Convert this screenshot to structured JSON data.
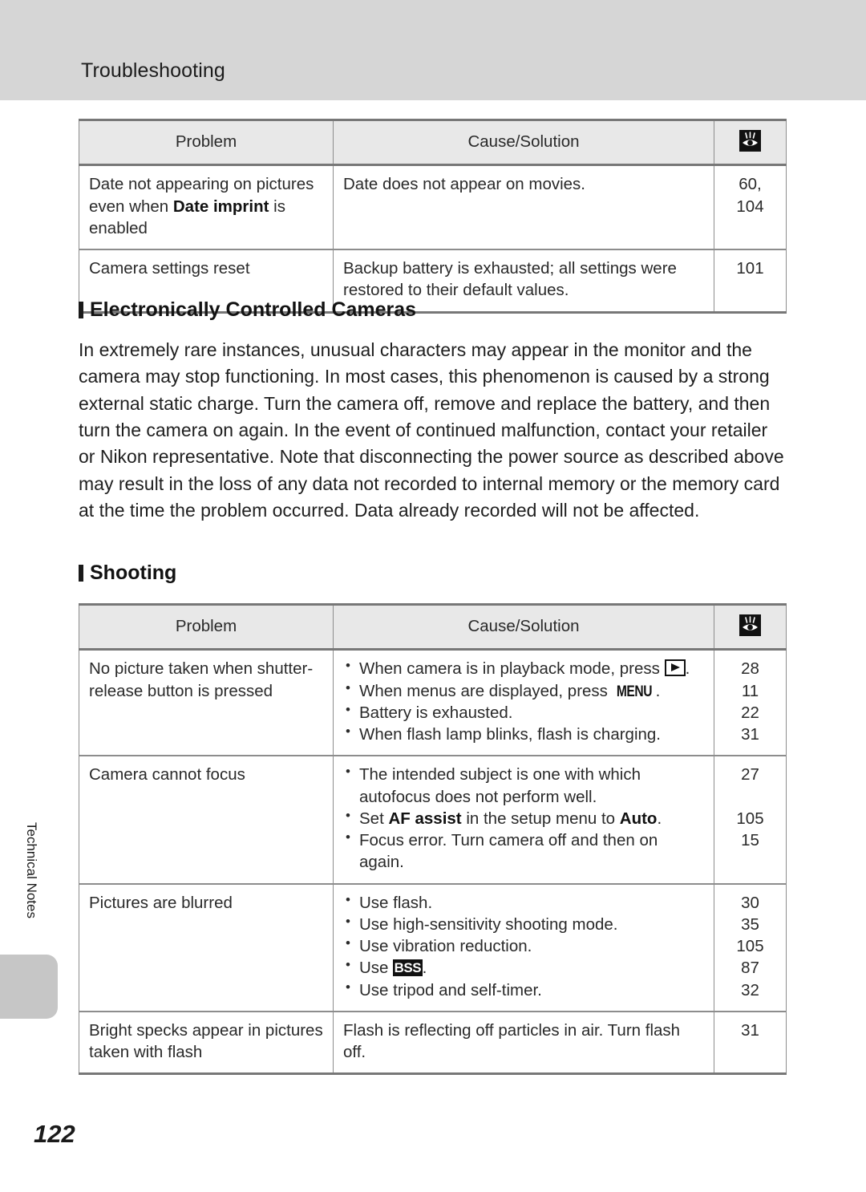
{
  "header": {
    "title": "Troubleshooting"
  },
  "side_tab": {
    "label": "Technical Notes"
  },
  "footer": {
    "page_number": "122"
  },
  "table_columns": {
    "problem": "Problem",
    "cause_solution": "Cause/Solution",
    "reference_icon": "reference-page-icon"
  },
  "table_one": {
    "rows": [
      {
        "problem_pre": "Date not appearing on pictures even when ",
        "problem_bold": "Date imprint",
        "problem_post": " is enabled",
        "cause": "Date does not appear on movies.",
        "refs": [
          "60, 104"
        ]
      },
      {
        "problem_pre": "Camera settings reset",
        "problem_bold": "",
        "problem_post": "",
        "cause": "Backup battery is exhausted; all settings were restored to their default values.",
        "refs": [
          "101"
        ]
      }
    ]
  },
  "section_electronic": {
    "heading": "Electronically Controlled Cameras",
    "paragraph": "In extremely rare instances, unusual characters may appear in the monitor and the camera may stop functioning. In most cases, this phenomenon is caused by a strong external static charge. Turn the camera off, remove and replace the battery, and then turn the camera on again. In the event of continued malfunction, contact your retailer or Nikon representative. Note that disconnecting the power source as described above may result in the loss of any data not recorded to internal memory or the memory card at the time the problem occurred. Data already recorded will not be affected."
  },
  "section_shooting": {
    "heading": "Shooting"
  },
  "table_two": {
    "rows": [
      {
        "problem": "No picture taken when shutter-release button is pressed",
        "bullets": [
          {
            "pre": "When camera is in playback mode, press ",
            "glyph": "playback-icon",
            "post": "."
          },
          {
            "pre": "When menus are displayed, press ",
            "glyph": "menu-icon",
            "post": "."
          },
          {
            "pre": "Battery is exhausted.",
            "glyph": "",
            "post": ""
          },
          {
            "pre": "When flash lamp blinks, flash is charging.",
            "glyph": "",
            "post": ""
          }
        ],
        "refs": [
          "28",
          "11",
          "22",
          "31"
        ]
      },
      {
        "problem": "Camera cannot focus",
        "bullets": [
          {
            "pre": "The intended subject is one with which autofocus does not perform well.",
            "glyph": "",
            "post": ""
          },
          {
            "pre": "Set ",
            "bold1": "AF assist",
            "mid": " in the setup menu to ",
            "bold2": "Auto",
            "post": "."
          },
          {
            "pre": "Focus error. Turn camera off and then on again.",
            "glyph": "",
            "post": ""
          }
        ],
        "refs": [
          "27",
          "",
          "105",
          "15"
        ]
      },
      {
        "problem": "Pictures are blurred",
        "bullets": [
          {
            "pre": "Use flash.",
            "glyph": "",
            "post": ""
          },
          {
            "pre": "Use high-sensitivity shooting mode.",
            "glyph": "",
            "post": ""
          },
          {
            "pre": "Use vibration reduction.",
            "glyph": "",
            "post": ""
          },
          {
            "pre": "Use ",
            "glyph": "bss-icon",
            "post": "."
          },
          {
            "pre": "Use tripod and self-timer.",
            "glyph": "",
            "post": ""
          }
        ],
        "refs": [
          "30",
          "35",
          "105",
          "87",
          "32"
        ]
      },
      {
        "problem": "Bright specks appear in pictures taken with flash",
        "cause": "Flash is reflecting off particles in air. Turn flash off.",
        "refs": [
          "31"
        ]
      }
    ]
  },
  "glyph_labels": {
    "bss": "BSS",
    "menu": "MENU"
  },
  "colors": {
    "header_band": "#d6d6d6",
    "table_header_fill": "#e8e8e8",
    "rule_heavy": "#777777",
    "rule_light": "#8d8d8d",
    "tab_gray": "#c6c6c6"
  }
}
